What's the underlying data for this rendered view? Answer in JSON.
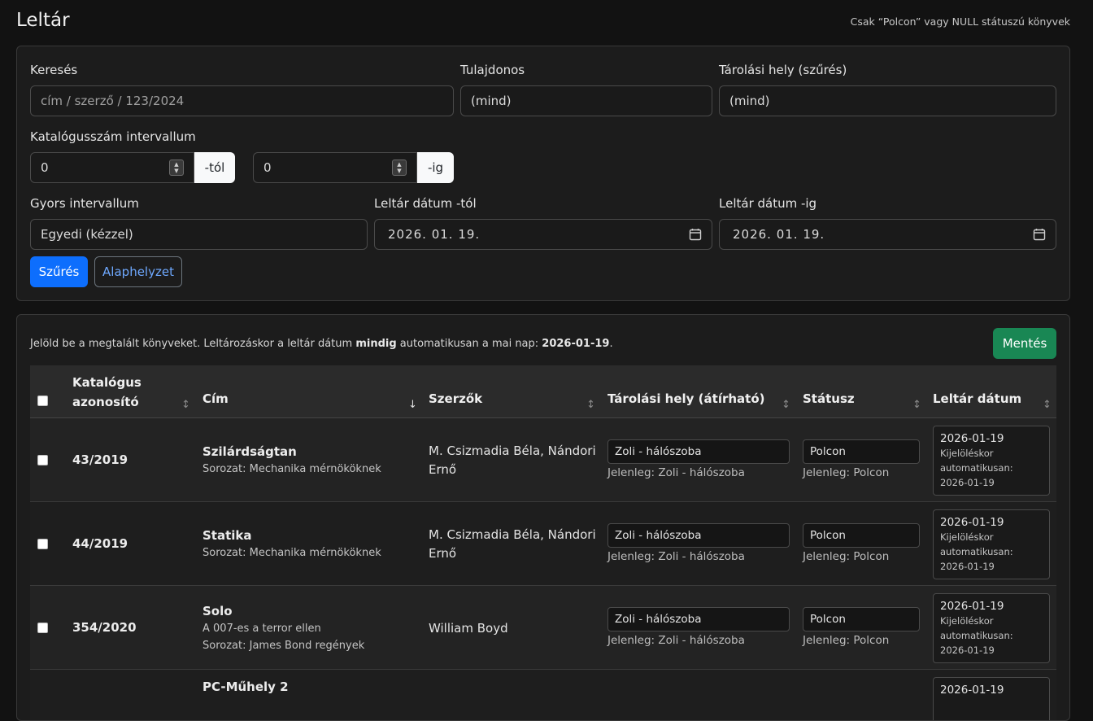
{
  "header": {
    "title": "Leltár",
    "note": "Csak “Polcon” vagy NULL státuszú könyvek"
  },
  "filters": {
    "search": {
      "label": "Keresés",
      "placeholder": "cím / szerző / 123/2024"
    },
    "owner": {
      "label": "Tulajdonos",
      "value": "(mind)"
    },
    "storage": {
      "label": "Tárolási hely (szűrés)",
      "value": "(mind)"
    },
    "catalog_range": {
      "label": "Katalógusszám intervallum",
      "from_value": "0",
      "from_suffix": "-tól",
      "to_value": "0",
      "to_suffix": "-ig"
    },
    "quick_range": {
      "label": "Gyors intervallum",
      "value": "Egyedi (kézzel)"
    },
    "date_from": {
      "label": "Leltár dátum -tól",
      "value": "2026. 01. 19."
    },
    "date_to": {
      "label": "Leltár dátum -ig",
      "value": "2026. 01. 19."
    },
    "filter_button": "Szűrés",
    "reset_button": "Alaphelyzet"
  },
  "inventory": {
    "info_prefix": "Jelöld be a megtalált könyveket. Leltározáskor a leltár dátum ",
    "info_bold": "mindig",
    "info_middle": " automatikusan a mai nap: ",
    "info_date": "2026-01-19",
    "info_suffix": ".",
    "save_button": "Mentés",
    "columns": {
      "catalog_line1": "Katalógus",
      "catalog_line2": "azonosító",
      "title": "Cím",
      "authors": "Szerzők",
      "storage": "Tárolási hely (átírható)",
      "status": "Státusz",
      "inventory_date": "Leltár dátum"
    },
    "rows": [
      {
        "catalog_id": "43/2019",
        "title": "Szilárdságtan",
        "subtitle": "",
        "series": "Sorozat: Mechanika mérnököknek",
        "authors_line1": "M. Csizmadia Béla, Nándori",
        "authors_line2": "Ernő",
        "storage": "Zoli - hálószoba",
        "storage_current": "Jelenleg: Zoli - hálószoba",
        "status": "Polcon",
        "status_current": "Jelenleg: Polcon",
        "date": "2026-01-19",
        "date_note1": "Kijelöléskor",
        "date_note2": "automatikusan:",
        "date_note3": "2026-01-19"
      },
      {
        "catalog_id": "44/2019",
        "title": "Statika",
        "subtitle": "",
        "series": "Sorozat: Mechanika mérnököknek",
        "authors_line1": "M. Csizmadia Béla, Nándori",
        "authors_line2": "Ernő",
        "storage": "Zoli - hálószoba",
        "storage_current": "Jelenleg: Zoli - hálószoba",
        "status": "Polcon",
        "status_current": "Jelenleg: Polcon",
        "date": "2026-01-19",
        "date_note1": "Kijelöléskor",
        "date_note2": "automatikusan:",
        "date_note3": "2026-01-19"
      },
      {
        "catalog_id": "354/2020",
        "title": "Solo",
        "subtitle": "A 007-es a terror ellen",
        "series": "Sorozat: James Bond regények",
        "authors_line1": "William Boyd",
        "authors_line2": "",
        "storage": "Zoli - hálószoba",
        "storage_current": "Jelenleg: Zoli - hálószoba",
        "status": "Polcon",
        "status_current": "Jelenleg: Polcon",
        "date": "2026-01-19",
        "date_note1": "Kijelöléskor",
        "date_note2": "automatikusan:",
        "date_note3": "2026-01-19"
      },
      {
        "catalog_id": "",
        "title": "PC-Műhely 2",
        "date": "2026-01-19"
      }
    ]
  }
}
